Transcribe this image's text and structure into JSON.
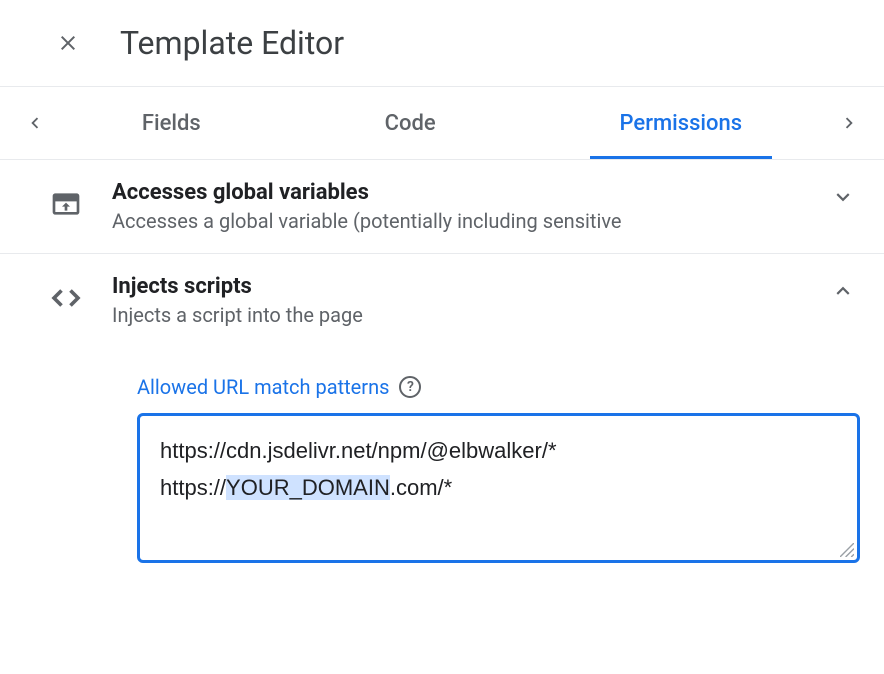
{
  "header": {
    "title": "Template Editor"
  },
  "tabs": {
    "items": [
      {
        "label": "Fields",
        "active": false
      },
      {
        "label": "Code",
        "active": false
      },
      {
        "label": "Permissions",
        "active": true
      }
    ]
  },
  "panels": [
    {
      "title": "Accesses global variables",
      "subtitle": "Accesses a global variable (potentially including sensitive",
      "expanded": false
    },
    {
      "title": "Injects scripts",
      "subtitle": "Injects a script into the page",
      "expanded": true,
      "field_label": "Allowed URL match patterns",
      "url_patterns": {
        "line1": "https://cdn.jsdelivr.net/npm/@elbwalker/*",
        "line2_pre": "https://",
        "line2_highlight": "YOUR_DOMAIN",
        "line2_post": ".com/*"
      }
    }
  ]
}
